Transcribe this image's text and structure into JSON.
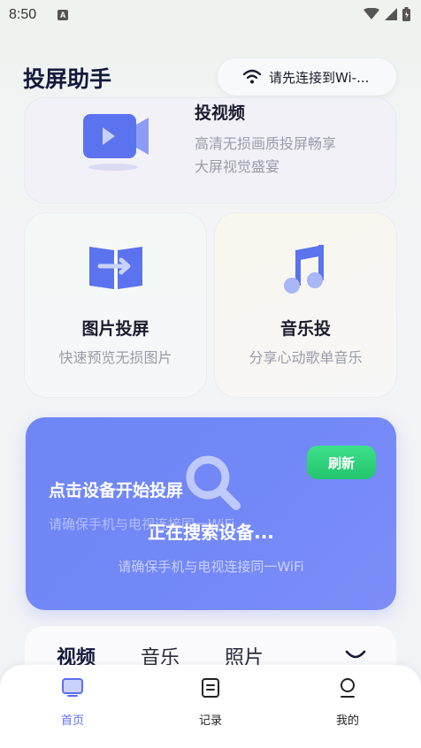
{
  "status_bar": {
    "time": "8:50",
    "notification_icon": "A"
  },
  "header": {
    "title": "投屏助手",
    "wifi_status": "请先连接到Wi-..."
  },
  "video_card": {
    "title_cut": "投视频",
    "line1": "高清无损画质投屏畅享",
    "line2": "大屏视觉盛宴"
  },
  "feature_cards": [
    {
      "title": "图片投屏",
      "desc": "快速预览无损图片",
      "icon": "photo-cast-icon"
    },
    {
      "title": "音乐投",
      "desc": "分享心动歌单音乐",
      "icon": "music-note-icon"
    }
  ],
  "search_card": {
    "hint_title": "点击设备开始投屏",
    "hint_sub": "请确保手机与电视连接同一WiFi",
    "searching": "正在搜索设备...",
    "tip": "请确保手机与电视连接同一WiFi",
    "refresh": "刷新"
  },
  "media_tabs": [
    "视频",
    "音乐",
    "照片"
  ],
  "bottom_nav": [
    {
      "label": "首页",
      "icon": "cast-screen-icon",
      "active": true
    },
    {
      "label": "记录",
      "icon": "record-icon",
      "active": false
    },
    {
      "label": "我的",
      "icon": "profile-icon",
      "active": false
    }
  ],
  "colors": {
    "accent": "#5b6ef0",
    "search_card": "#7388f7",
    "refresh": "#2ecf78",
    "title": "#141a3c"
  }
}
